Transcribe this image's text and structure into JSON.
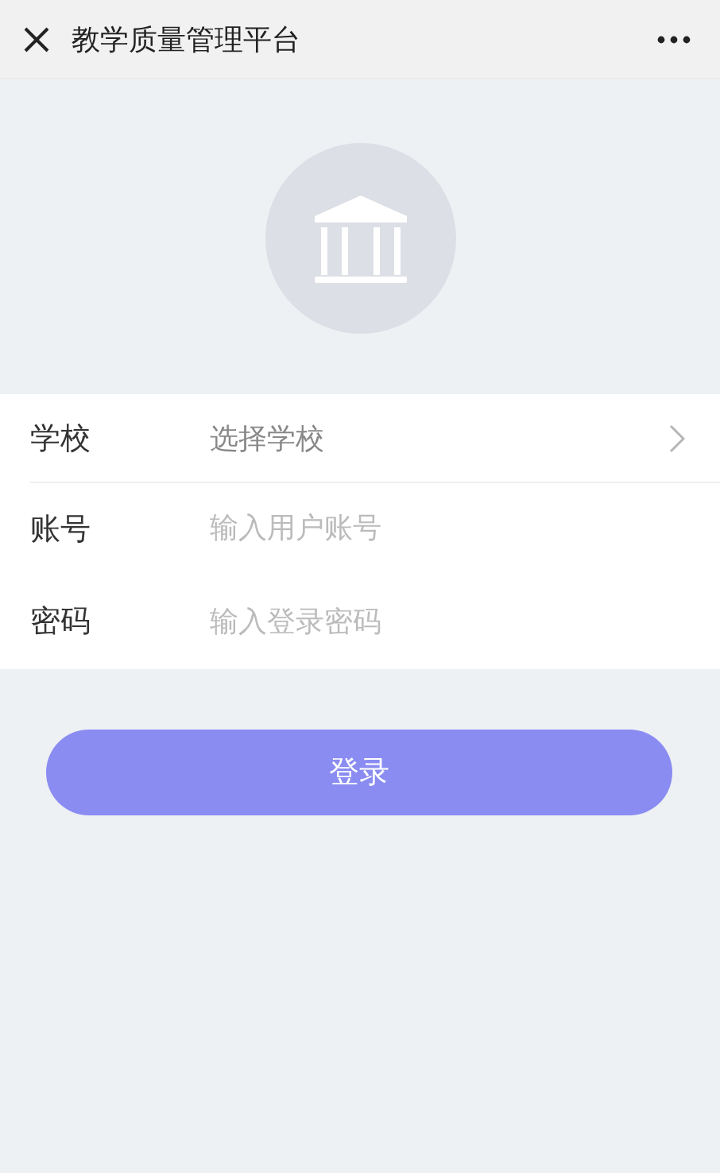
{
  "title_bar": {
    "title": "教学质量管理平台"
  },
  "form": {
    "fields": [
      {
        "kind": "select",
        "label": "学校",
        "placeholder": "选择学校"
      },
      {
        "kind": "input",
        "label": "账号",
        "placeholder": "输入用户账号"
      },
      {
        "kind": "password",
        "label": "密码",
        "placeholder": "输入登录密码"
      }
    ]
  },
  "login_button": {
    "label": "登录"
  }
}
